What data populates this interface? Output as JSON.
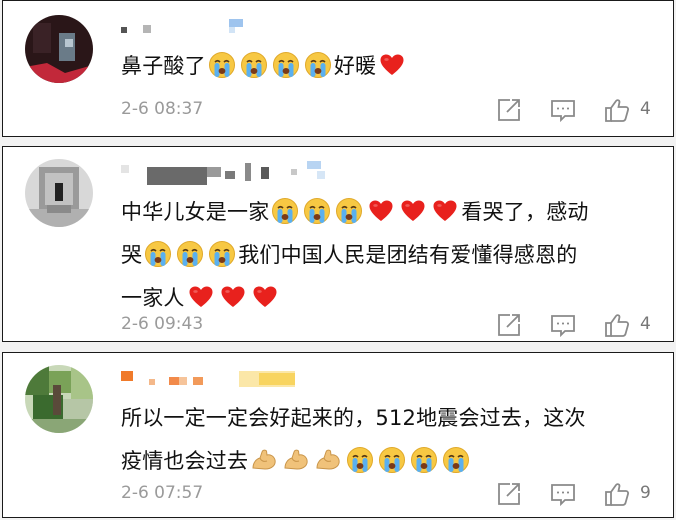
{
  "comments": [
    {
      "text_before": "鼻子酸了",
      "text_after": "好暖",
      "time": "2-6 08:37",
      "likes": "4"
    },
    {
      "line1a": "中华儿女是一家",
      "line1b": "看哭了，感动",
      "line2a": "哭",
      "line2b": "我们中国人民是团结有爱懂得感恩的",
      "line3": "一家人",
      "time": "2-6 09:43",
      "likes": "4"
    },
    {
      "line1": "所以一定一定会好起来的，512地震会过去，这次",
      "line2": "疫情也会过去",
      "time": "2-6 07:57",
      "likes": "9"
    }
  ],
  "icons": {
    "crying": "crying-face-icon",
    "heart": "red-heart-icon",
    "muscle": "flexed-biceps-icon",
    "share": "share-icon",
    "comment": "comment-icon",
    "like": "thumbs-up-icon"
  },
  "colors": {
    "heart": "#e8211d",
    "emoji_yellow": "#f7c843",
    "tears": "#5ab0f0",
    "time": "#9a9a9a",
    "border": "#1a1a1a"
  }
}
